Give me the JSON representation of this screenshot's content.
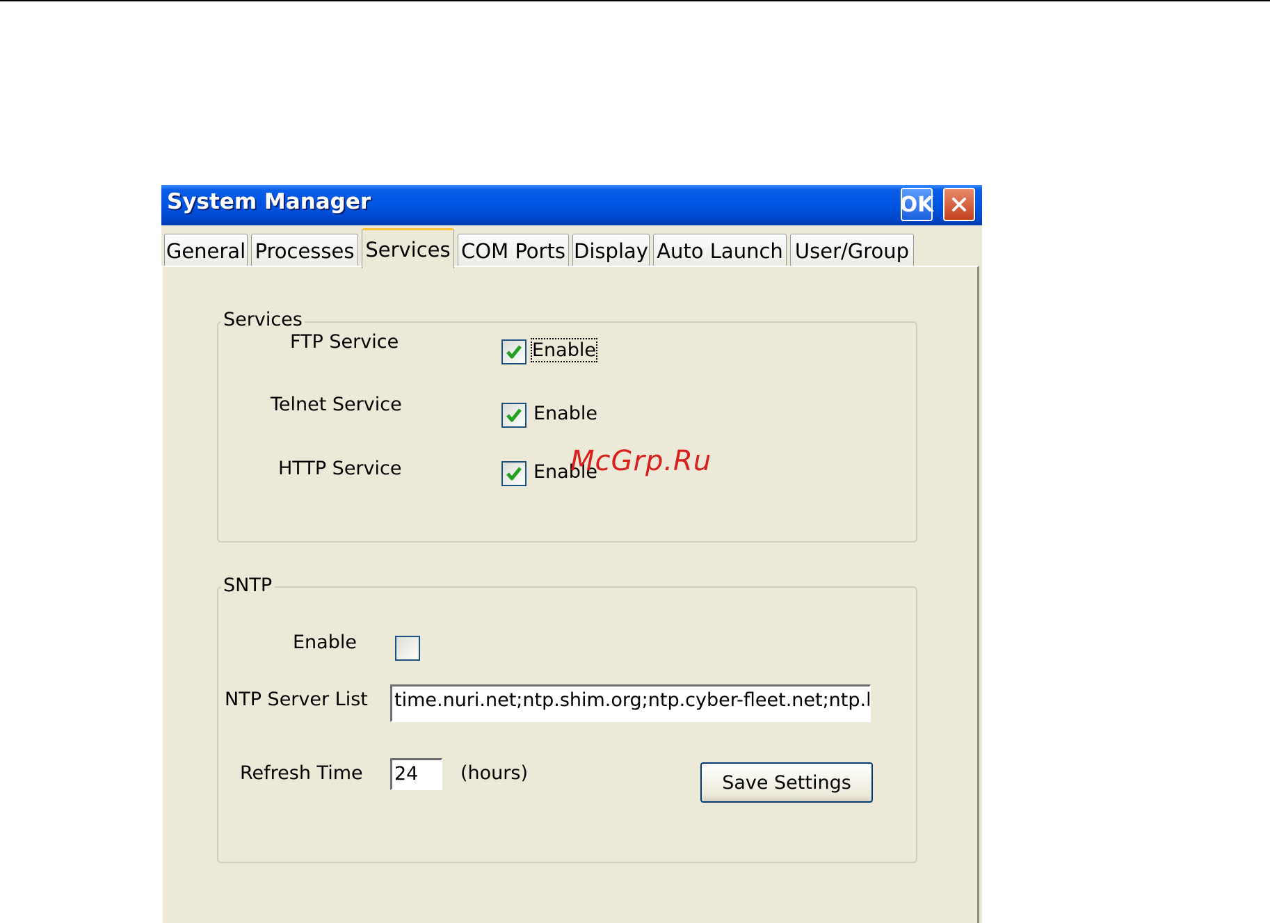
{
  "window": {
    "title": "System Manager",
    "ok_label": "OK",
    "close_label": "✕"
  },
  "tabs": [
    {
      "label": "General",
      "active": false
    },
    {
      "label": "Processes",
      "active": false
    },
    {
      "label": "Services",
      "active": true
    },
    {
      "label": "COM Ports",
      "active": false
    },
    {
      "label": "Display",
      "active": false
    },
    {
      "label": "Auto Launch",
      "active": false
    },
    {
      "label": "User/Group",
      "active": false
    }
  ],
  "services_group": {
    "title": "Services",
    "items": [
      {
        "label": "FTP Service",
        "checkbox_label": "Enable",
        "checked": true
      },
      {
        "label": "Telnet Service",
        "checkbox_label": "Enable",
        "checked": true
      },
      {
        "label": "HTTP Service",
        "checkbox_label": "Enable",
        "checked": true
      }
    ]
  },
  "sntp_group": {
    "title": "SNTP",
    "enable_label": "Enable",
    "enable_checked": false,
    "ntp_label": "NTP Server List",
    "ntp_value": "time.nuri.net;ntp.shim.org;ntp.cyber-fleet.net;ntp.landau",
    "refresh_label": "Refresh Time",
    "refresh_value": "24",
    "refresh_unit": "(hours)",
    "save_label": "Save Settings"
  },
  "watermark": "McGrp.Ru",
  "colors": {
    "titlebar": "#0054e3",
    "window_bg": "#ece9d8",
    "check_green": "#21a121",
    "watermark": "#d8201e"
  }
}
